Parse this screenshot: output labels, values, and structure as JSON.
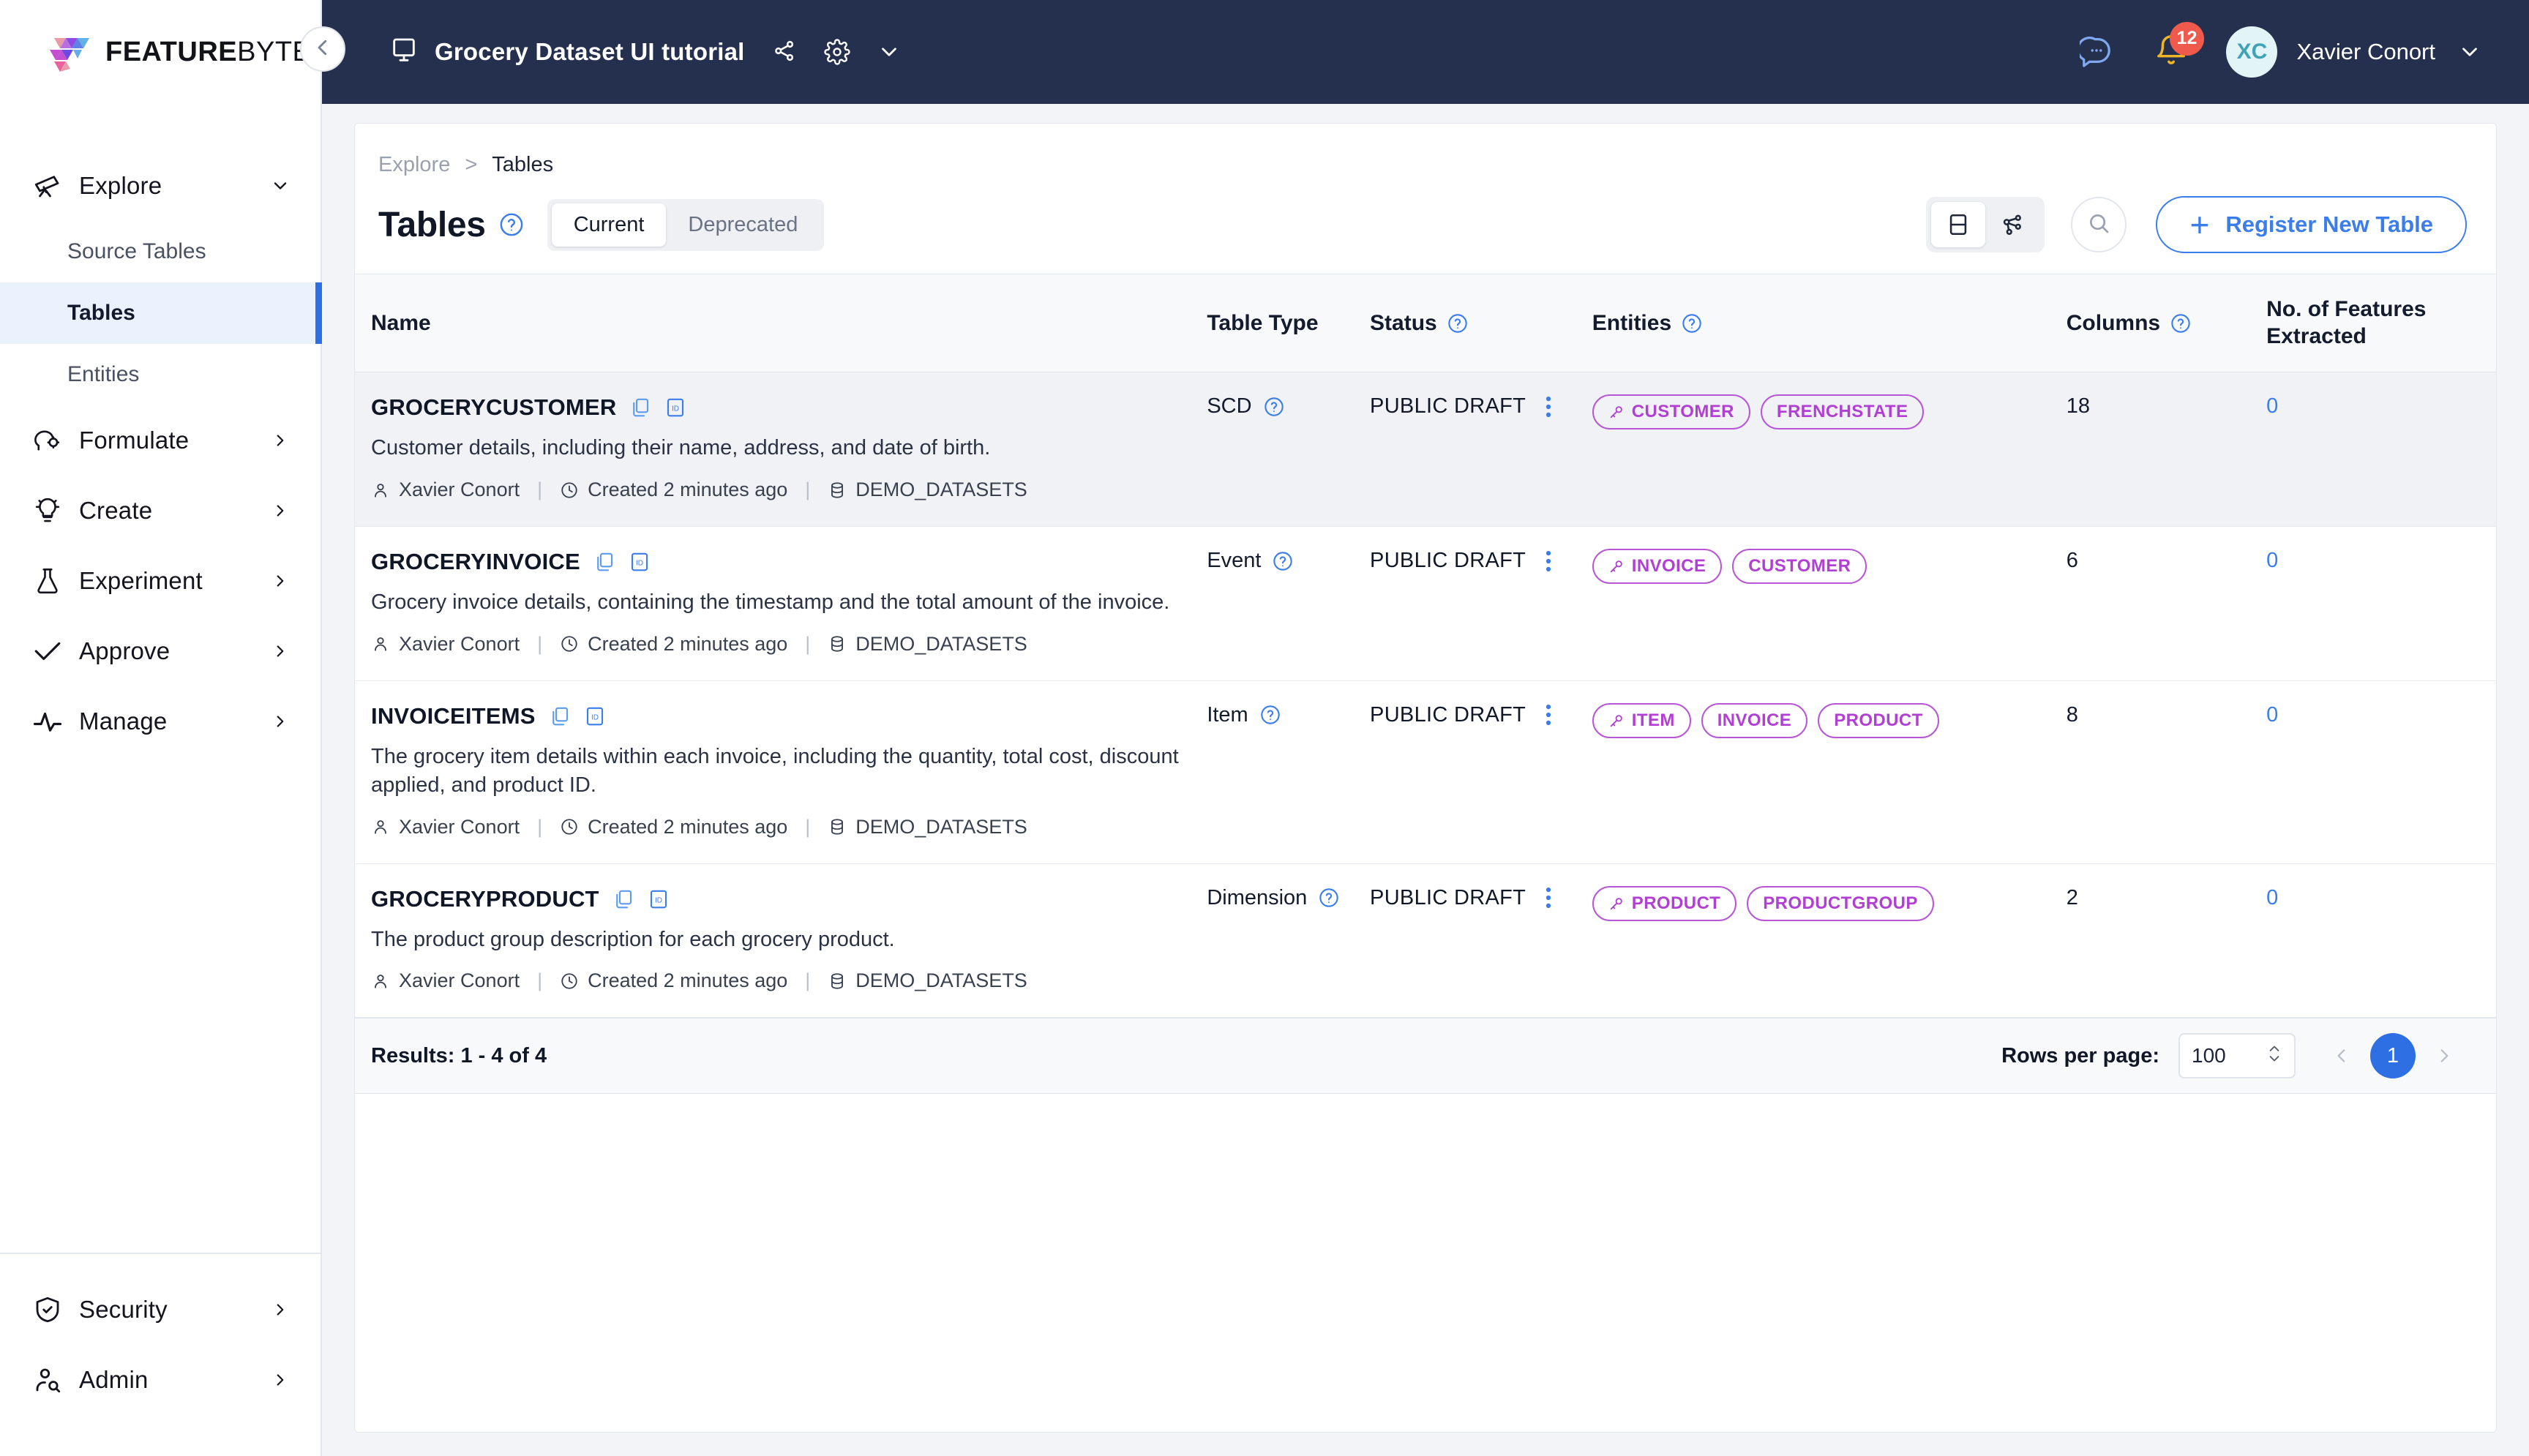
{
  "brand": {
    "name_bold": "FEATURE",
    "name_light": "BYTE"
  },
  "topbar": {
    "workspace_title": "Grocery Dataset UI tutorial",
    "monitor_icon": "monitor-icon",
    "share_icon": "share-icon",
    "settings_icon": "gear-icon",
    "chevron_icon": "chevron-down-icon",
    "chat_icon": "chat-icon",
    "bell_icon": "bell-icon",
    "notification_count": "12",
    "avatar_initials": "XC",
    "user_name": "Xavier Conort",
    "bg_color": "#25304f",
    "badge_color": "#ef5a4c"
  },
  "sidebar": {
    "collapse_icon": "chevron-left-icon",
    "groups": [
      {
        "label": "Explore",
        "icon": "telescope-icon",
        "expanded": true,
        "children": [
          {
            "label": "Source Tables",
            "active": false
          },
          {
            "label": "Tables",
            "active": true
          },
          {
            "label": "Entities",
            "active": false
          }
        ]
      },
      {
        "label": "Formulate",
        "icon": "brain-gear-icon",
        "expanded": false,
        "children": []
      },
      {
        "label": "Create",
        "icon": "lightbulb-icon",
        "expanded": false,
        "children": []
      },
      {
        "label": "Experiment",
        "icon": "flask-icon",
        "expanded": false,
        "children": []
      },
      {
        "label": "Approve",
        "icon": "check-icon",
        "expanded": false,
        "children": []
      },
      {
        "label": "Manage",
        "icon": "activity-icon",
        "expanded": false,
        "children": []
      }
    ],
    "bottom": [
      {
        "label": "Security",
        "icon": "shield-check-icon"
      },
      {
        "label": "Admin",
        "icon": "user-search-icon"
      }
    ]
  },
  "breadcrumb": {
    "parent": "Explore",
    "separator": ">",
    "current": "Tables"
  },
  "page": {
    "title": "Tables",
    "title_help_icon": "help-circle-icon",
    "tabs": [
      {
        "label": "Current",
        "active": true
      },
      {
        "label": "Deprecated",
        "active": false
      }
    ],
    "view_toggle": [
      {
        "icon": "table-view-icon",
        "active": true
      },
      {
        "icon": "graph-view-icon",
        "active": false
      }
    ],
    "search_icon": "search-icon",
    "register_button": {
      "label": "Register New Table",
      "icon": "plus-icon",
      "color": "#3b7dea"
    }
  },
  "table": {
    "columns": [
      {
        "label": "Name",
        "help": false
      },
      {
        "label": "Table Type",
        "help": false
      },
      {
        "label": "Status",
        "help": true
      },
      {
        "label": "Entities",
        "help": true
      },
      {
        "label": "Columns",
        "help": true
      },
      {
        "label": "No. of Features Extracted",
        "help": false
      }
    ],
    "rows": [
      {
        "name": "GROCERYCUSTOMER",
        "description": "Customer details, including their name, address, and date of birth.",
        "author": "Xavier Conort",
        "created": "Created 2 minutes ago",
        "datasource": "DEMO_DATASETS",
        "table_type": "SCD",
        "type_help": true,
        "status": "PUBLIC DRAFT",
        "entities": [
          {
            "label": "CUSTOMER",
            "primary": true
          },
          {
            "label": "FRENCHSTATE",
            "primary": false
          }
        ],
        "columns_count": "18",
        "features_extracted": "0",
        "highlighted": true
      },
      {
        "name": "GROCERYINVOICE",
        "description": "Grocery invoice details, containing the timestamp and the total amount of the invoice.",
        "author": "Xavier Conort",
        "created": "Created 2 minutes ago",
        "datasource": "DEMO_DATASETS",
        "table_type": "Event",
        "type_help": true,
        "status": "PUBLIC DRAFT",
        "entities": [
          {
            "label": "INVOICE",
            "primary": true
          },
          {
            "label": "CUSTOMER",
            "primary": false
          }
        ],
        "columns_count": "6",
        "features_extracted": "0",
        "highlighted": false
      },
      {
        "name": "INVOICEITEMS",
        "description": "The grocery item details within each invoice, including the quantity, total cost, discount applied, and product ID.",
        "author": "Xavier Conort",
        "created": "Created 2 minutes ago",
        "datasource": "DEMO_DATASETS",
        "table_type": "Item",
        "type_help": true,
        "status": "PUBLIC DRAFT",
        "entities": [
          {
            "label": "ITEM",
            "primary": true
          },
          {
            "label": "INVOICE",
            "primary": false
          },
          {
            "label": "PRODUCT",
            "primary": false
          }
        ],
        "columns_count": "8",
        "features_extracted": "0",
        "highlighted": false
      },
      {
        "name": "GROCERYPRODUCT",
        "description": "The product group description for each grocery product.",
        "author": "Xavier Conort",
        "created": "Created 2 minutes ago",
        "datasource": "DEMO_DATASETS",
        "table_type": "Dimension",
        "type_help": true,
        "status": "PUBLIC DRAFT",
        "entities": [
          {
            "label": "PRODUCT",
            "primary": true
          },
          {
            "label": "PRODUCTGROUP",
            "primary": false
          }
        ],
        "columns_count": "2",
        "features_extracted": "0",
        "highlighted": false
      }
    ]
  },
  "footer": {
    "results_text": "Results: 1 - 4 of 4",
    "rows_per_page_label": "Rows per page:",
    "rows_per_page_value": "100",
    "prev_icon": "chevron-left-icon",
    "next_icon": "chevron-right-icon",
    "current_page": "1"
  },
  "colors": {
    "accent_blue": "#2f6fe4",
    "link_blue": "#3b7dea",
    "entity_purple": "#b13fd4",
    "navy": "#25304f",
    "danger_red": "#ef5a4c"
  }
}
